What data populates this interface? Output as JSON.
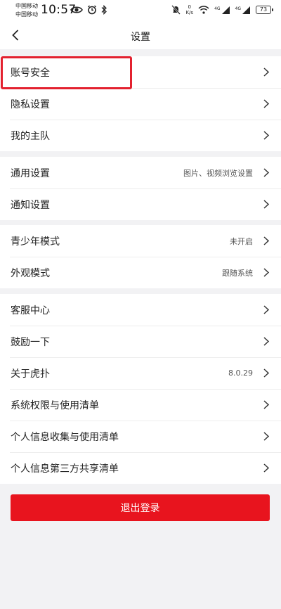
{
  "status_bar": {
    "carrier_1": "中国移动",
    "carrier_2": "中国移动",
    "time": "10:57",
    "net_speed_value": "0",
    "net_speed_unit": "K/s",
    "signal_1_label": "4G",
    "signal_2_label": "4G",
    "battery_level": "73",
    "icons": [
      "eye-icon",
      "alarm-icon",
      "bluetooth-icon",
      "mute-icon",
      "wifi-icon",
      "signal-icon",
      "battery-icon"
    ]
  },
  "nav": {
    "title": "设置",
    "back_icon": "chevron-left-icon"
  },
  "groups": [
    {
      "rows": [
        {
          "label": "账号安全",
          "value": ""
        },
        {
          "label": "隐私设置",
          "value": ""
        },
        {
          "label": "我的主队",
          "value": ""
        }
      ]
    },
    {
      "rows": [
        {
          "label": "通用设置",
          "value": "图片、视频浏览设置"
        },
        {
          "label": "通知设置",
          "value": ""
        }
      ]
    },
    {
      "rows": [
        {
          "label": "青少年模式",
          "value": "未开启"
        },
        {
          "label": "外观模式",
          "value": "跟随系统"
        }
      ]
    },
    {
      "rows": [
        {
          "label": "客服中心",
          "value": ""
        },
        {
          "label": "鼓励一下",
          "value": ""
        },
        {
          "label": "关于虎扑",
          "value": "8.0.29"
        },
        {
          "label": "系统权限与使用清单",
          "value": ""
        },
        {
          "label": "个人信息收集与使用清单",
          "value": ""
        },
        {
          "label": "个人信息第三方共享清单",
          "value": ""
        }
      ]
    }
  ],
  "logout_label": "退出登录",
  "colors": {
    "accent": "#e8141e",
    "highlight": "#e3212f",
    "background": "#f2f2f4"
  }
}
